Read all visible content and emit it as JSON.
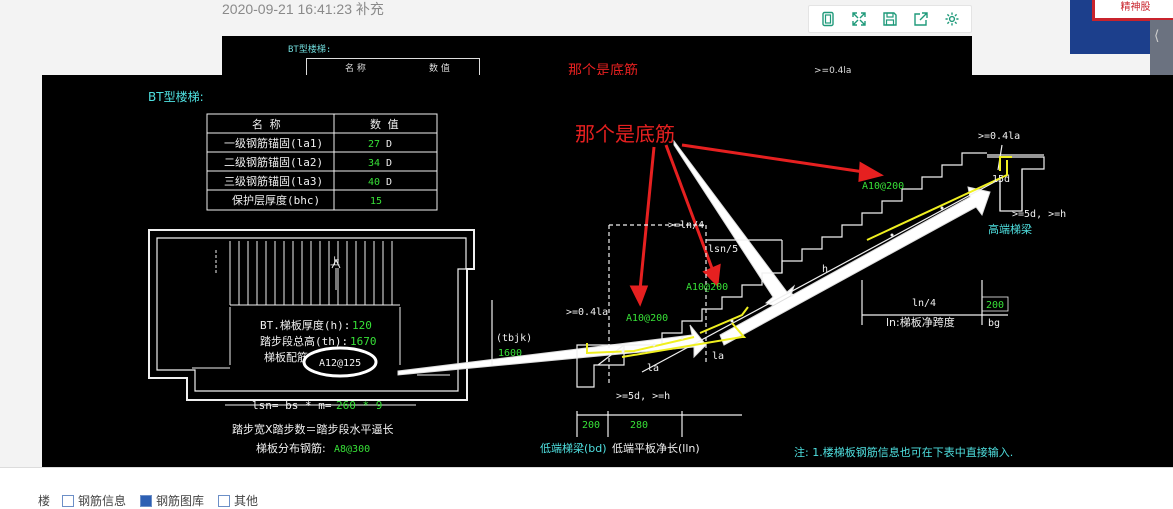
{
  "post": {
    "timestamp_label": "2020-09-21 16:41:23 补充"
  },
  "toolbar": {
    "buttons": [
      {
        "name": "fit-icon"
      },
      {
        "name": "fullscreen-icon"
      },
      {
        "name": "save-icon"
      },
      {
        "name": "share-icon"
      },
      {
        "name": "settings-icon"
      }
    ]
  },
  "right_ad": {
    "text": "精神股"
  },
  "drawing": {
    "type_title": "BT型楼梯:",
    "table": {
      "headers": [
        "名 称",
        "数 值"
      ],
      "rows": [
        {
          "name": "一级钢筋锚固(la1)",
          "value": "27",
          "unit": "D"
        },
        {
          "name": "二级钢筋锚固(la2)",
          "value": "34",
          "unit": "D"
        },
        {
          "name": "三级钢筋锚固(la3)",
          "value": "40",
          "unit": "D"
        },
        {
          "name": "保护层厚度(bhc)",
          "value": "15",
          "unit": ""
        }
      ]
    },
    "plan": {
      "thickness_label": "BT.梯板厚度(h):",
      "thickness_value": "120",
      "height_label": "踏步段总高(th):",
      "height_value": "1670",
      "rebar_label": "梯板配筋",
      "rebar_value": "A12@125",
      "up_label": "上",
      "lsn_label": "lsn= bs * m=",
      "lsn_value": "260 * 9",
      "step_formula": "踏步宽X踏步数＝踏步段水平逼长",
      "distribution_label": "梯板分布钢筋:",
      "distribution_value": "A8@300"
    },
    "annotation": {
      "text": "那个是底筋",
      "color": "#e62020"
    },
    "section": {
      "rebar_top": "A10@200",
      "rebar_mid": "A10@200",
      "rebar_low": "A10@200",
      "anchor_high": ">=0.4la",
      "anchor_low": ">=0.4la",
      "ln4_top": ">=ln/4",
      "lsn5": "lsn/5",
      "h_label": "h",
      "la1": "la",
      "la2": "la",
      "d5_low": ">=5d, >=h",
      "d5_high": ">=5d, >=h",
      "ten_d": "15d",
      "tbjk": "(tbjk)",
      "tbjk_value": "1600",
      "ln4": "ln/4",
      "bg_value": "200",
      "ln_net": "ln:梯板净跨度",
      "bg": "bg",
      "bd_value": "200",
      "lln_value": "280",
      "low_beam": "低端梯梁(bd)",
      "low_platform": "低端平板净长(lln)",
      "high_beam": "高端梯梁"
    },
    "note": "注: 1.楼梯板钢筋信息也可在下表中直接输入."
  },
  "behind": {
    "title": "BT型楼梯:",
    "h1": "名 称",
    "h2": "数 值",
    "annotation": "那个是底筋",
    "misc": ">=0.4la"
  },
  "bottom_bar": {
    "items": [
      "楼",
      "钢筋信息",
      "钢筋图库",
      "其他"
    ]
  },
  "colors": {
    "cad_bg": "#000000",
    "cyan": "#4fe0e0",
    "green": "#37e037",
    "yellow": "#f0f020",
    "white": "#f0f0f0",
    "red": "#e62020"
  }
}
